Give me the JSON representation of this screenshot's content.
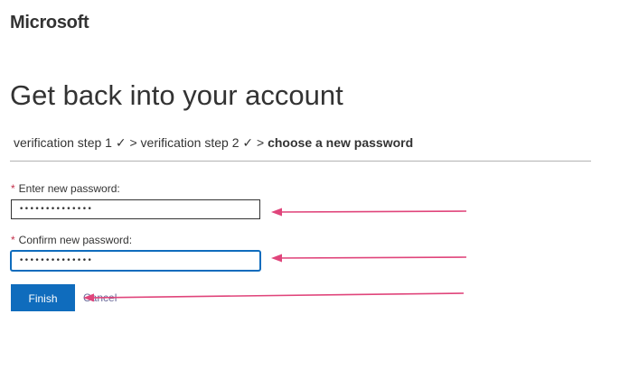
{
  "brand": {
    "logo_text": "Microsoft"
  },
  "page": {
    "title": "Get back into your account"
  },
  "breadcrumb": {
    "step1": "verification step 1 ✓",
    "sep1": " > ",
    "step2": "verification step 2 ✓",
    "sep2": " > ",
    "current": "choose a new password"
  },
  "form": {
    "new_password": {
      "required_mark": "*",
      "label": "Enter new password:",
      "value": "••••••••••••••"
    },
    "confirm_password": {
      "required_mark": "*",
      "label": "Confirm new password:",
      "value": "••••••••••••••"
    },
    "finish_label": "Finish",
    "cancel_label": "Cancel"
  },
  "colors": {
    "accent": "#0f6cbd",
    "required": "#c4314b",
    "annotation_arrow": "#e0457b"
  }
}
